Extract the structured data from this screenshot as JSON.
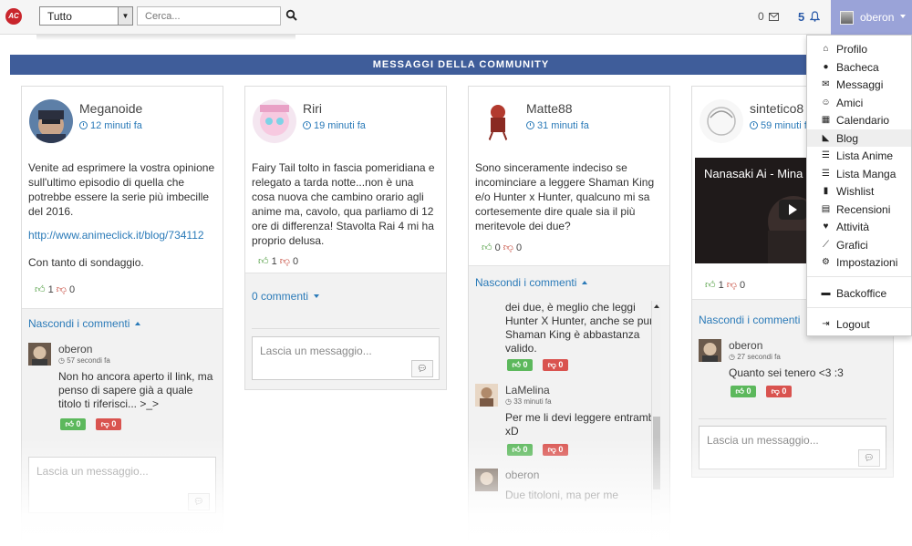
{
  "topbar": {
    "logo_text": "AC",
    "filter_value": "Tutto",
    "search_placeholder": "Cerca...",
    "messages_count": "0",
    "notifications_count": "5",
    "username": "oberon"
  },
  "section_title": "MESSAGGI DELLA COMMUNITY",
  "posts": [
    {
      "author": "Meganoide",
      "time": "12 minuti fa",
      "text": "Venite ad esprimere la vostra opinione sull'ultimo episodio di quella che potrebbe essere la serie più imbecille del 2016.",
      "link": "http://www.animeclick.it/blog/734112",
      "text2": "Con tanto di sondaggio.",
      "likes": "1",
      "dislikes": "0",
      "toggle_label": "Nascondi i commenti",
      "comments": [
        {
          "author": "oberon",
          "time": "57 secondi fa",
          "text": "Non ho ancora aperto il link, ma penso di sapere già a quale titolo ti riferisci... >_>",
          "likes": "0",
          "dislikes": "0"
        }
      ],
      "input_placeholder": "Lascia un messaggio..."
    },
    {
      "author": "Riri",
      "time": "19 minuti fa",
      "text": "Fairy Tail tolto in fascia pomeridiana e relegato a tarda notte...non è una cosa nuova che cambino orario agli anime ma, cavolo, qua parliamo di 12 ore di differenza! Stavolta Rai 4 mi ha proprio delusa.",
      "likes": "1",
      "dislikes": "0",
      "toggle_label": "0 commenti",
      "input_placeholder": "Lascia un messaggio..."
    },
    {
      "author": "Matte88",
      "time": "31 minuti fa",
      "text": "Sono sinceramente indeciso se incominciare a leggere Shaman King e/o Hunter x Hunter, qualcuno mi sa cortesemente dire quale sia il più meritevole dei due?",
      "likes": "0",
      "dislikes": "0",
      "toggle_label": "Nascondi i commenti",
      "comments": [
        {
          "author": "",
          "time": "",
          "text": "dei due, è meglio che leggi Hunter X Hunter, anche se pure Shaman King è abbastanza valido.",
          "likes": "0",
          "dislikes": "0"
        },
        {
          "author": "LaMelina",
          "time": "33 minuti fa",
          "text": "Per me li devi leggere entrambi! xD",
          "likes": "0",
          "dislikes": "0"
        },
        {
          "author": "oberon",
          "time": "",
          "text": "Due titoloni, ma per me",
          "likes": "",
          "dislikes": ""
        }
      ]
    },
    {
      "author": "sintetico8",
      "time": "59 minuti fa",
      "video_title": "Nanasaki Ai - Mina",
      "likes": "1",
      "dislikes": "0",
      "toggle_label": "Nascondi i commenti",
      "comments": [
        {
          "author": "oberon",
          "time": "27 secondi fa",
          "text": "Quanto sei tenero <3 :3",
          "likes": "0",
          "dislikes": "0"
        }
      ],
      "input_placeholder": "Lascia un messaggio..."
    }
  ],
  "dropdown": {
    "items": [
      {
        "label": "Profilo",
        "icon": "home-icon"
      },
      {
        "label": "Bacheca",
        "icon": "chat-icon"
      },
      {
        "label": "Messaggi",
        "icon": "envelope-icon"
      },
      {
        "label": "Amici",
        "icon": "smile-icon"
      },
      {
        "label": "Calendario",
        "icon": "calendar-icon"
      },
      {
        "label": "Blog",
        "icon": "rss-icon"
      },
      {
        "label": "Lista Anime",
        "icon": "list-icon"
      },
      {
        "label": "Lista Manga",
        "icon": "list-icon"
      },
      {
        "label": "Wishlist",
        "icon": "bookmark-icon"
      },
      {
        "label": "Recensioni",
        "icon": "book-icon"
      },
      {
        "label": "Attività",
        "icon": "heartbeat-icon"
      },
      {
        "label": "Grafici",
        "icon": "chart-icon"
      },
      {
        "label": "Impostazioni",
        "icon": "gear-icon"
      }
    ],
    "backoffice": "Backoffice",
    "logout": "Logout"
  },
  "colors": {
    "accent": "#3f5d9a",
    "link": "#2a7ab8",
    "user_menu": "#9aa3d8",
    "like": "#5cb85c",
    "dislike": "#d9534f"
  }
}
